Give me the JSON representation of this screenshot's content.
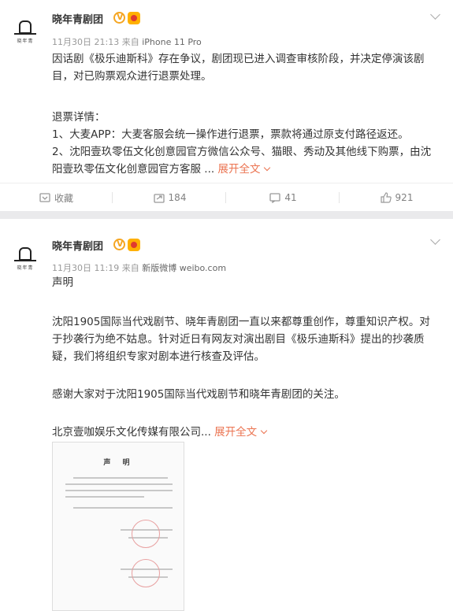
{
  "colors": {
    "accent_link": "#eb7350",
    "meta_gray": "#999999",
    "badge_v": "#f5a623",
    "vip_gold": "#ffb000"
  },
  "posts": [
    {
      "user": {
        "name": "晓年青剧团",
        "avatar_text": "晓年青",
        "verified_icon": "v-badge-icon",
        "vip_icon": "vip-badge-icon"
      },
      "meta": {
        "time": "11月30日 21:13",
        "from": "来自",
        "device": "iPhone 11 Pro"
      },
      "lines": [
        "因话剧《极乐迪斯科》存在争议，剧团现已进入调查审核阶段，并决定停演该剧",
        "目，对已购票观众进行退票处理。",
        "",
        "退票详情：",
        "1、大麦APP：大麦客服会统一操作进行退票，票款将通过原支付路径返还。",
        "2、沈阳壹玖零伍文化创意园官方微信公众号、猫眼、秀动及其他线下购票，由沈"
      ],
      "last_line": "阳壹玖零伍文化创意园官方客服 ...",
      "expand_label": "展开全文",
      "actions": [
        {
          "icon": "bookmark-icon",
          "label": "收藏"
        },
        {
          "icon": "share-icon",
          "label": "184"
        },
        {
          "icon": "comment-icon",
          "label": "41"
        },
        {
          "icon": "like-icon",
          "label": "921"
        }
      ]
    },
    {
      "user": {
        "name": "晓年青剧团",
        "avatar_text": "晓年青",
        "verified_icon": "v-badge-icon",
        "vip_icon": "vip-badge-icon"
      },
      "meta": {
        "time": "11月30日 11:19",
        "from": "来自",
        "device": "新版微博 weibo.com"
      },
      "lines": [
        "声明",
        "",
        "沈阳1905国际当代戏剧节、晓年青剧团一直以来都尊重创作，尊重知识产权。对",
        "于抄袭行为绝不姑息。针对近日有网友对演出剧目《极乐迪斯科》提出的抄袭质",
        "疑，我们将组织专家对剧本进行核查及评估。",
        "",
        "感谢大家对于沈阳1905国际当代戏剧节和晓年青剧团的关注。",
        ""
      ],
      "last_line": "北京壹咖娱乐文化传媒有限公司...",
      "expand_label": "展开全文",
      "attachment": {
        "title": "声  明"
      }
    }
  ]
}
